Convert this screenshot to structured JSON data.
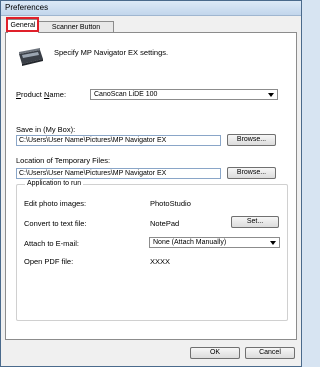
{
  "window": {
    "title": "Preferences"
  },
  "tabs": [
    {
      "label": "General"
    },
    {
      "label": "Scanner Button Settings"
    }
  ],
  "general": {
    "description": "Specify MP Navigator EX settings.",
    "product_name": {
      "label": "Product Name:",
      "value": "CanoScan LiDE 100"
    },
    "save_in": {
      "label": "Save in (My Box):",
      "value": "C:\\Users\\User Name\\Pictures\\MP Navigator EX",
      "browse": "Browse..."
    },
    "temp_location": {
      "label": "Location of Temporary Files:",
      "value": "C:\\Users\\User Name\\Pictures\\MP Navigator EX",
      "browse": "Browse..."
    },
    "apps": {
      "title": "Application to run",
      "edit_photo": {
        "label": "Edit photo images:",
        "value": "PhotoStudio"
      },
      "convert_text": {
        "label": "Convert to text file:",
        "value": "NotePad",
        "set": "Set..."
      },
      "attach_email": {
        "label": "Attach to E-mail:",
        "value": "None (Attach Manually)"
      },
      "open_pdf": {
        "label": "Open PDF file:",
        "value": "XXXX"
      }
    }
  },
  "footer": {
    "ok": "OK",
    "cancel": "Cancel"
  }
}
